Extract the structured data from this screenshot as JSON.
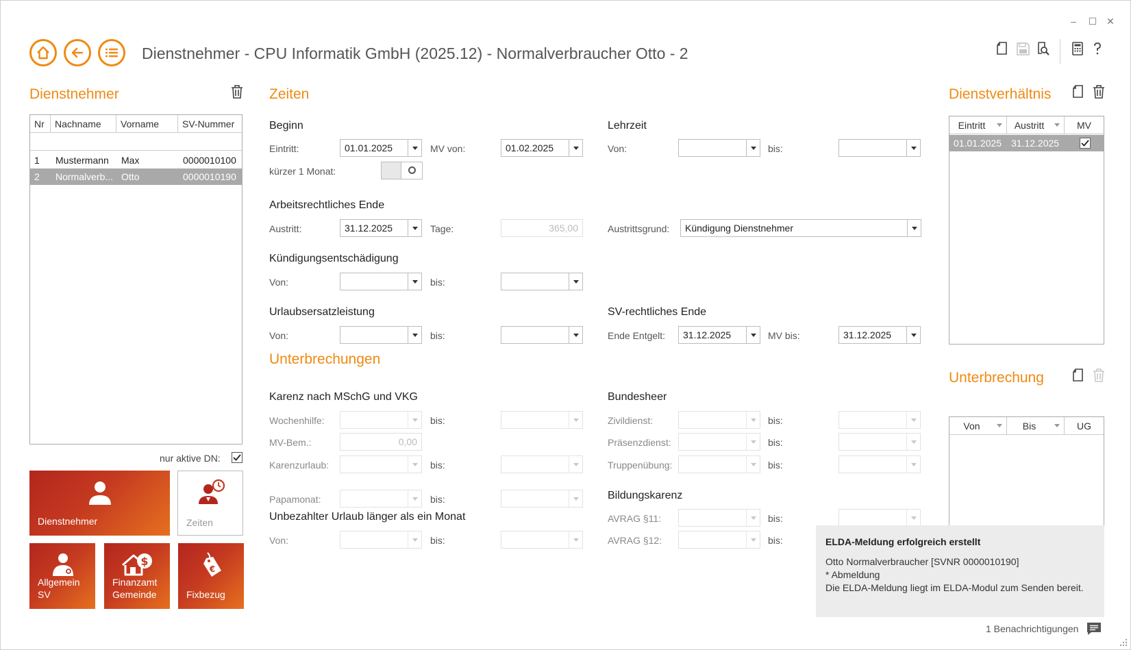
{
  "window": {
    "title": "Dienstnehmer - CPU Informatik GmbH (2025.12) - Normalverbraucher Otto - 2",
    "minimize": "–",
    "maximize": "☐",
    "close": "✕"
  },
  "left": {
    "title": "Dienstnehmer",
    "columns": [
      "Nr",
      "Nachname",
      "Vorname",
      "SV-Nummer"
    ],
    "rows": [
      {
        "nr": "1",
        "nachname": "Mustermann",
        "vorname": "Max",
        "sv": "0000010100"
      },
      {
        "nr": "2",
        "nachname": "Normalverb...",
        "vorname": "Otto",
        "sv": "0000010190"
      }
    ],
    "active_only_label": "nur aktive DN:",
    "active_only_checked": true,
    "tiles": {
      "dienstnehmer": "Dienstnehmer",
      "zeiten": "Zeiten",
      "allgemein_1": "Allgemein",
      "allgemein_2": "SV",
      "finanzamt_1": "Finanzamt",
      "finanzamt_2": "Gemeinde",
      "fixbezug": "Fixbezug"
    }
  },
  "zeiten": {
    "title": "Zeiten",
    "beginn": {
      "title": "Beginn",
      "eintritt_label": "Eintritt:",
      "eintritt_value": "01.01.2025",
      "mv_von_label": "MV von:",
      "mv_von_value": "01.02.2025",
      "kuerzer_label": "kürzer 1 Monat:"
    },
    "lehrzeit": {
      "title": "Lehrzeit",
      "von_label": "Von:",
      "bis_label": "bis:"
    },
    "arbeitsrechtliches_ende": {
      "title": "Arbeitsrechtliches Ende",
      "austritt_label": "Austritt:",
      "austritt_value": "31.12.2025",
      "tage_label": "Tage:",
      "tage_value": "365,00",
      "grund_label": "Austrittsgrund:",
      "grund_value": "Kündigung Dienstnehmer"
    },
    "kuendigung": {
      "title": "Kündigungsentschädigung",
      "von_label": "Von:",
      "bis_label": "bis:"
    },
    "urlaubsersatz": {
      "title": "Urlaubsersatzleistung",
      "von_label": "Von:",
      "bis_label": "bis:"
    },
    "sv_ende": {
      "title": "SV-rechtliches Ende",
      "ende_label": "Ende Entgelt:",
      "ende_value": "31.12.2025",
      "mv_bis_label": "MV bis:",
      "mv_bis_value": "31.12.2025"
    }
  },
  "unterbrechungen": {
    "title": "Unterbrechungen",
    "karenz": {
      "title": "Karenz nach MSchG und VKG",
      "wochenhilfe_label": "Wochenhilfe:",
      "mv_bem_label": "MV-Bem.:",
      "mv_bem_value": "0,00",
      "karenzurlaub_label": "Karenzurlaub:",
      "papamonat_label": "Papamonat:",
      "bis_label": "bis:"
    },
    "unbezahlt": {
      "title": "Unbezahlter Urlaub länger als ein Monat",
      "von_label": "Von:",
      "bis_label": "bis:"
    },
    "bundesheer": {
      "title": "Bundesheer",
      "zivildienst_label": "Zivildienst:",
      "praesenzdienst_label": "Präsenzdienst:",
      "truppenuebung_label": "Truppenübung:",
      "bis_label": "bis:"
    },
    "bildungskarenz": {
      "title": "Bildungskarenz",
      "avrag11_label": "AVRAG §11:",
      "avrag12_label": "AVRAG §12:",
      "bis_label": "bis:"
    }
  },
  "dienstverhaeltnis": {
    "title": "Dienstverhältnis",
    "columns": [
      "Eintritt",
      "Austritt",
      "MV"
    ],
    "rows": [
      {
        "eintritt": "01.01.2025",
        "austritt": "31.12.2025",
        "mv_checked": true
      }
    ]
  },
  "unterbrechung": {
    "title": "Unterbrechung",
    "columns": [
      "Von",
      "Bis",
      "UG"
    ]
  },
  "notification": {
    "title": "ELDA-Meldung erfolgreich erstellt",
    "line1": "Otto Normalverbraucher [SVNR 0000010190]",
    "line2": "* Abmeldung",
    "line3": "Die ELDA-Meldung liegt im ELDA-Modul zum Senden bereit."
  },
  "statusbar": {
    "notifications": "1 Benachrichtigungen"
  },
  "colors": {
    "accent": "#ef8a12",
    "tile_dark": "#b3261e",
    "tile_light": "#e6701f",
    "selection": "#a9a9a9"
  }
}
